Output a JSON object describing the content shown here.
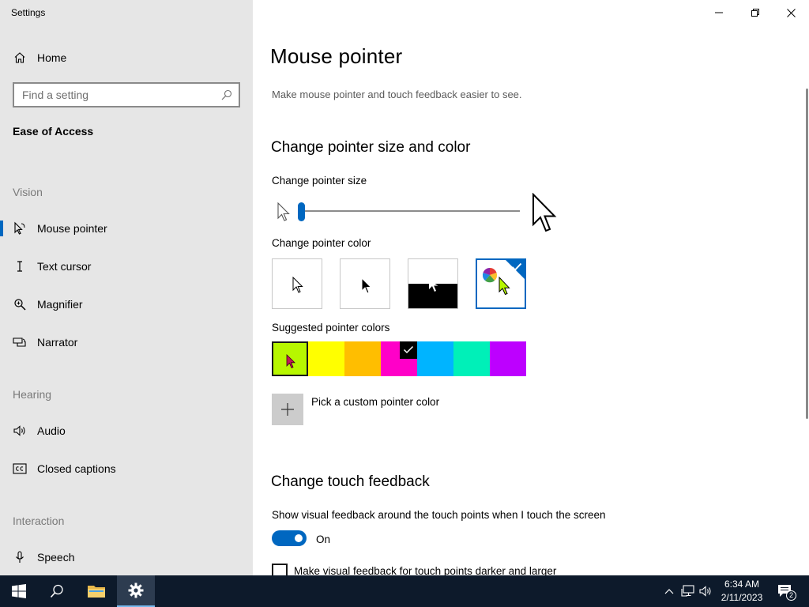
{
  "app": {
    "title": "Settings"
  },
  "sidebar": {
    "home_label": "Home",
    "search_placeholder": "Find a setting",
    "section_title": "Ease of Access",
    "groups": {
      "vision": "Vision",
      "hearing": "Hearing",
      "interaction": "Interaction"
    },
    "items": [
      {
        "label": "Mouse pointer",
        "icon": "mouse-pointer-icon",
        "selected": true
      },
      {
        "label": "Text cursor",
        "icon": "text-cursor-icon"
      },
      {
        "label": "Magnifier",
        "icon": "magnifier-icon"
      },
      {
        "label": "Narrator",
        "icon": "narrator-icon"
      },
      {
        "label": "Audio",
        "icon": "speaker-icon"
      },
      {
        "label": "Closed captions",
        "icon": "closed-captions-icon"
      },
      {
        "label": "Speech",
        "icon": "microphone-icon"
      }
    ]
  },
  "main": {
    "title": "Mouse pointer",
    "description": "Make mouse pointer and touch feedback easier to see.",
    "pointer_section": {
      "heading": "Change pointer size and color",
      "size_label": "Change pointer size",
      "size_value": 1,
      "color_label": "Change pointer color",
      "color_options": [
        "white",
        "black",
        "inverted",
        "custom"
      ],
      "selected_color_option": "custom",
      "suggested_label": "Suggested pointer colors",
      "suggested_colors": [
        "#b7f700",
        "#ffff00",
        "#ffbe00",
        "#ff00c8",
        "#00b4ff",
        "#00f0b8",
        "#bd00ff"
      ],
      "selected_suggested": 3,
      "custom_label": "Pick a custom pointer color"
    },
    "touch_section": {
      "heading": "Change touch feedback",
      "feedback_label": "Show visual feedback around the touch points when I touch the screen",
      "toggle_state": "On",
      "darker_label": "Make visual feedback for touch points darker and larger"
    }
  },
  "taskbar": {
    "time": "6:34 AM",
    "date": "2/11/2023",
    "notification_count": "2"
  },
  "colors": {
    "accent": "#0067c0",
    "sidebar_bg": "#e6e6e6",
    "taskbar_bg": "#0d1a2b"
  }
}
